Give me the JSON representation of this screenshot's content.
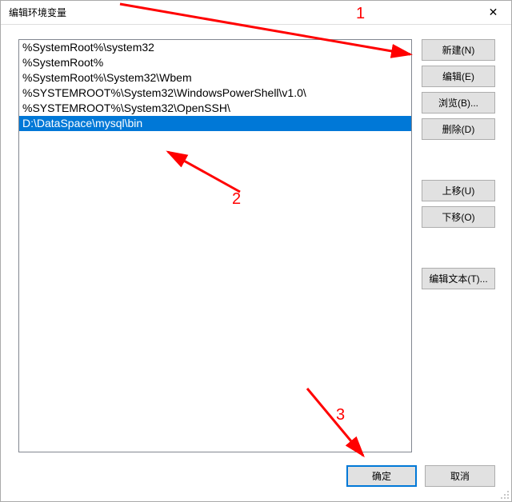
{
  "window": {
    "title": "编辑环境变量",
    "close_symbol": "✕"
  },
  "list": {
    "items": [
      {
        "text": "%SystemRoot%\\system32",
        "selected": false
      },
      {
        "text": "%SystemRoot%",
        "selected": false
      },
      {
        "text": "%SystemRoot%\\System32\\Wbem",
        "selected": false
      },
      {
        "text": "%SYSTEMROOT%\\System32\\WindowsPowerShell\\v1.0\\",
        "selected": false
      },
      {
        "text": "%SYSTEMROOT%\\System32\\OpenSSH\\",
        "selected": false
      },
      {
        "text": "D:\\DataSpace\\mysql\\bin",
        "selected": true
      }
    ]
  },
  "buttons": {
    "new": "新建(N)",
    "edit": "编辑(E)",
    "browse": "浏览(B)...",
    "delete": "删除(D)",
    "moveup": "上移(U)",
    "movedown": "下移(O)",
    "edittext": "编辑文本(T)...",
    "ok": "确定",
    "cancel": "取消"
  },
  "annotations": {
    "n1": "1",
    "n2": "2",
    "n3": "3"
  }
}
